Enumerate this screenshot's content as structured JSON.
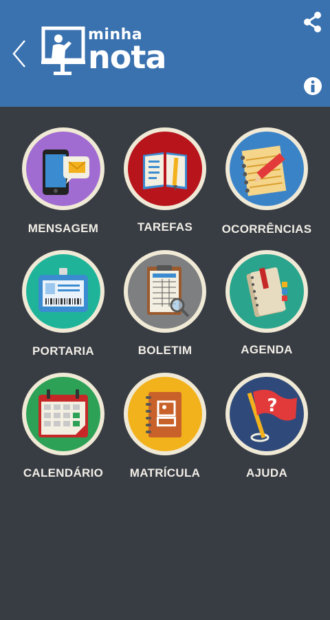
{
  "header": {
    "logo_small": "minha",
    "logo_big": "nota",
    "back_icon": "chevron-left-icon",
    "share_icon": "share-icon",
    "info_icon": "info-icon",
    "bg_color": "#3a72b0"
  },
  "menu": {
    "items": [
      {
        "label": "MENSAGEM",
        "icon": "message-icon",
        "color": "#a16cd1"
      },
      {
        "label": "TAREFAS",
        "icon": "homework-icon",
        "color": "#b8141c"
      },
      {
        "label": "OCORRÊNCIAS",
        "icon": "notebook-pencil-icon",
        "color": "#3b83c7"
      },
      {
        "label": "PORTARIA",
        "icon": "id-badge-icon",
        "color": "#1fb49a"
      },
      {
        "label": "BOLETIM",
        "icon": "report-card-icon",
        "color": "#7d7f80"
      },
      {
        "label": "AGENDA",
        "icon": "planner-icon",
        "color": "#2aa48c"
      },
      {
        "label": "CALENDÁRIO",
        "icon": "calendar-icon",
        "color": "#2da155"
      },
      {
        "label": "MATRÍCULA",
        "icon": "enrollment-icon",
        "color": "#f2b21c"
      },
      {
        "label": "AJUDA",
        "icon": "help-flag-icon",
        "color": "#2f4a7a"
      }
    ]
  },
  "background": "#383c43"
}
